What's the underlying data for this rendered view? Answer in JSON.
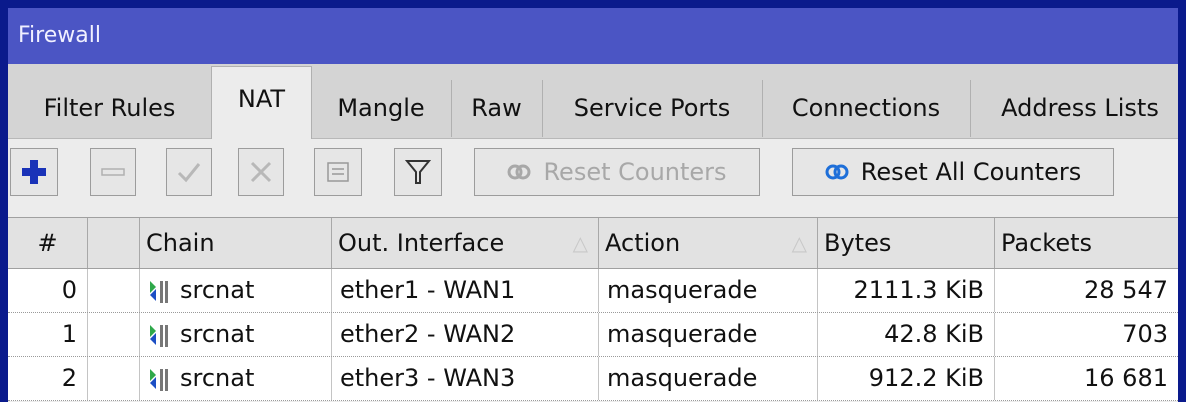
{
  "window": {
    "title": "Firewall"
  },
  "tabs": [
    {
      "label": "Filter Rules"
    },
    {
      "label": "NAT"
    },
    {
      "label": "Mangle"
    },
    {
      "label": "Raw"
    },
    {
      "label": "Service Ports"
    },
    {
      "label": "Connections"
    },
    {
      "label": "Address Lists"
    }
  ],
  "toolbar": {
    "reset_counters_label": "Reset Counters",
    "reset_all_counters_label": "Reset All Counters"
  },
  "table": {
    "columns": [
      "#",
      "",
      "Chain",
      "Out. Interface",
      "Action",
      "Bytes",
      "Packets"
    ],
    "rows": [
      {
        "index": "0",
        "chain": "srcnat",
        "out_interface": "ether1 - WAN1",
        "action": "masquerade",
        "bytes": "2111.3 KiB",
        "packets": "28 547"
      },
      {
        "index": "1",
        "chain": "srcnat",
        "out_interface": "ether2 - WAN2",
        "action": "masquerade",
        "bytes": "42.8 KiB",
        "packets": "703"
      },
      {
        "index": "2",
        "chain": "srcnat",
        "out_interface": "ether3 - WAN3",
        "action": "masquerade",
        "bytes": "912.2 KiB",
        "packets": "16 681"
      }
    ]
  },
  "colors": {
    "titlebar": "#4b55c4",
    "desktop": "#0a1a8c",
    "add_icon": "#1a33b8"
  }
}
